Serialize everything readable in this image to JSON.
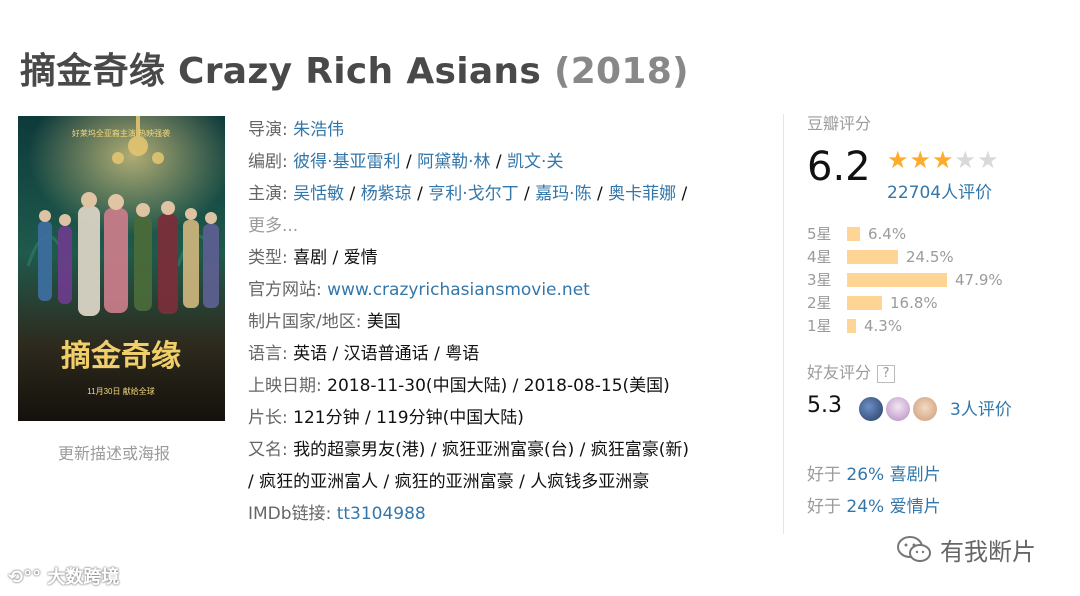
{
  "title": {
    "main": "摘金奇缘 Crazy Rich Asians",
    "year": "(2018)"
  },
  "poster": {
    "top_text": "好莱坞全亚裔主演 热映强袭",
    "title": "摘金奇缘",
    "date": "11月30日 献给全球"
  },
  "update_link": "更新描述或海报",
  "info": {
    "director_label": "导演",
    "director": "朱浩伟",
    "writers_label": "编剧",
    "writers": [
      "彼得·基亚雷利",
      "阿黛勒·林",
      "凯文·关"
    ],
    "cast_label": "主演",
    "cast": [
      "吴恬敏",
      "杨紫琼",
      "亨利·戈尔丁",
      "嘉玛·陈",
      "奥卡菲娜"
    ],
    "more": "更多...",
    "genre_label": "类型",
    "genres": "喜剧 / 爱情",
    "site_label": "官方网站",
    "site": "www.crazyrichasiansmovie.net",
    "country_label": "制片国家/地区",
    "country": "美国",
    "language_label": "语言",
    "language": "英语 / 汉语普通话 / 粤语",
    "release_label": "上映日期",
    "release": "2018-11-30(中国大陆) / 2018-08-15(美国)",
    "runtime_label": "片长",
    "runtime": "121分钟 / 119分钟(中国大陆)",
    "aka_label": "又名",
    "aka_line1": "我的超豪男友(港) / 疯狂亚洲富豪(台) / 疯狂富豪(新)",
    "aka_line2": "/ 疯狂的亚洲富人 / 疯狂的亚洲富豪 / 人疯钱多亚洲豪",
    "imdb_label": "IMDb链接",
    "imdb": "tt3104988"
  },
  "rating": {
    "label": "豆瓣评分",
    "score": "6.2",
    "stars_on": "★★★",
    "stars_off": "★★",
    "votes": "22704人评价",
    "distribution": [
      {
        "label": "5星",
        "pct": "6.4%",
        "value": 6.4
      },
      {
        "label": "4星",
        "pct": "24.5%",
        "value": 24.5
      },
      {
        "label": "3星",
        "pct": "47.9%",
        "value": 47.9
      },
      {
        "label": "2星",
        "pct": "16.8%",
        "value": 16.8
      },
      {
        "label": "1星",
        "pct": "4.3%",
        "value": 4.3
      }
    ],
    "bar_color": "#ffd596",
    "star_color": "#ffac2d"
  },
  "friend_rating": {
    "label": "好友评分",
    "help": "?",
    "score": "5.3",
    "votes": "3人评价"
  },
  "genre_rank": [
    {
      "prefix": "好于 ",
      "value": "26% 喜剧片"
    },
    {
      "prefix": "好于 ",
      "value": "24% 爱情片"
    }
  ],
  "watermark": {
    "left": "大数跨境",
    "right": "有我断片"
  }
}
